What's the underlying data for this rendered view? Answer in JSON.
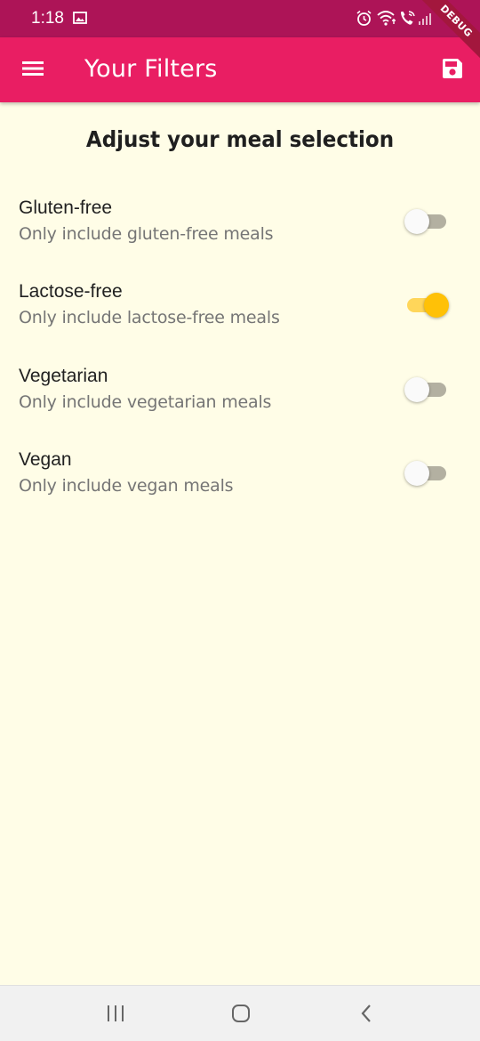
{
  "status_bar": {
    "time": "1:18",
    "icons": [
      "gallery-icon",
      "alarm-icon",
      "wifi-icon",
      "call-icon",
      "signal-icon"
    ]
  },
  "debug_banner": "DEBUG",
  "app_bar": {
    "title": "Your Filters",
    "leading_icon": "menu-icon",
    "action_icon": "save-icon",
    "color": "#e91e63",
    "status_color": "#ad1457"
  },
  "heading": "Adjust your meal selection",
  "filters": [
    {
      "title": "Gluten-free",
      "subtitle": "Only include gluten-free meals",
      "enabled": false
    },
    {
      "title": "Lactose-free",
      "subtitle": "Only include lactose-free meals",
      "enabled": true
    },
    {
      "title": "Vegetarian",
      "subtitle": "Only include vegetarian meals",
      "enabled": false
    },
    {
      "title": "Vegan",
      "subtitle": "Only include vegan meals",
      "enabled": false
    }
  ],
  "colors": {
    "background": "#fffde7",
    "switch_active": "#ffc107",
    "switch_inactive_track": "#b3b0a1"
  },
  "nav_bar": {
    "buttons": [
      "recents-icon",
      "home-icon",
      "back-icon"
    ]
  }
}
